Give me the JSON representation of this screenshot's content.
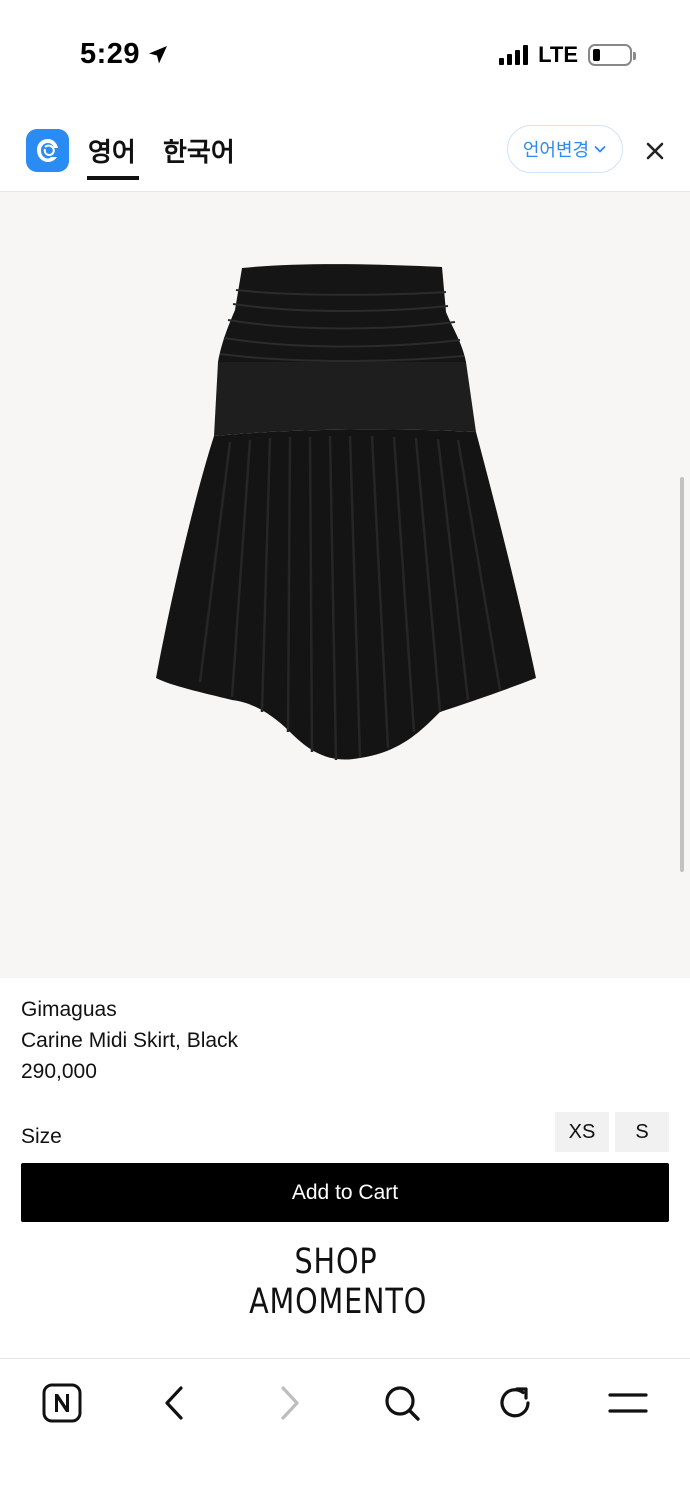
{
  "status": {
    "time": "5:29",
    "network": "LTE"
  },
  "translate": {
    "tab_source": "영어",
    "tab_target": "한국어",
    "change_label": "언어변경"
  },
  "product": {
    "brand": "Gimaguas",
    "name": "Carine Midi Skirt, Black",
    "price": "290,000",
    "size_label": "Size",
    "sizes": [
      "XS",
      "S"
    ],
    "add_to_cart": "Add to Cart"
  },
  "shop": {
    "line1": "SHOP",
    "line2": "AMOMENTO"
  },
  "toolbar": {
    "icons": [
      "naver-n-icon",
      "back-icon",
      "forward-icon",
      "search-icon",
      "reload-icon",
      "menu-icon"
    ]
  },
  "colors": {
    "accent": "#2a8bf2",
    "image_bg": "#f7f6f4",
    "button_bg": "#000000"
  }
}
